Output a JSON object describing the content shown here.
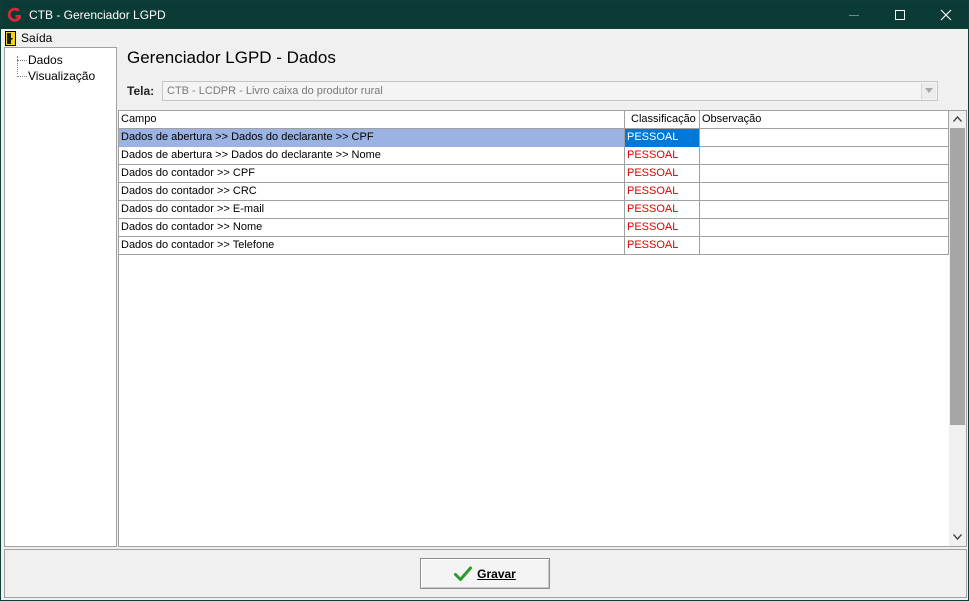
{
  "window": {
    "title": "CTB - Gerenciador LGPD",
    "controls": [
      "minimize-icon",
      "maximize-icon",
      "close-icon"
    ],
    "titlebar_color": "#0b3b35"
  },
  "menu": {
    "exit_label": "Saída",
    "exit_icon": "door-exit-icon"
  },
  "tree": {
    "items": [
      {
        "label": "Dados"
      },
      {
        "label": "Visualização"
      }
    ]
  },
  "main": {
    "page_title": "Gerenciador LGPD - Dados",
    "tela_label": "Tela:",
    "tela_value": "CTB - LCDPR - Livro caixa do produtor rural"
  },
  "grid": {
    "columns": [
      "Campo",
      "Classificação",
      "Observação"
    ],
    "rows": [
      {
        "campo": "Dados de abertura >>  Dados do declarante  >> CPF",
        "classificacao": "PESSOAL",
        "observacao": "",
        "selected": true
      },
      {
        "campo": "Dados de abertura >>  Dados do declarante  >> Nome",
        "classificacao": "PESSOAL",
        "observacao": ""
      },
      {
        "campo": "Dados do contador >> CPF",
        "classificacao": "PESSOAL",
        "observacao": ""
      },
      {
        "campo": "Dados do contador >> CRC",
        "classificacao": "PESSOAL",
        "observacao": ""
      },
      {
        "campo": "Dados do contador >> E-mail",
        "classificacao": "PESSOAL",
        "observacao": ""
      },
      {
        "campo": "Dados do contador >> Nome",
        "classificacao": "PESSOAL",
        "observacao": ""
      },
      {
        "campo": "Dados do contador >> Telefone",
        "classificacao": "PESSOAL",
        "observacao": ""
      }
    ],
    "classification_color": "#e00000",
    "selection_color": "#0078d7"
  },
  "footer": {
    "save_label": "Gravar",
    "save_icon": "checkmark-icon",
    "check_color": "#2e9a2e"
  }
}
